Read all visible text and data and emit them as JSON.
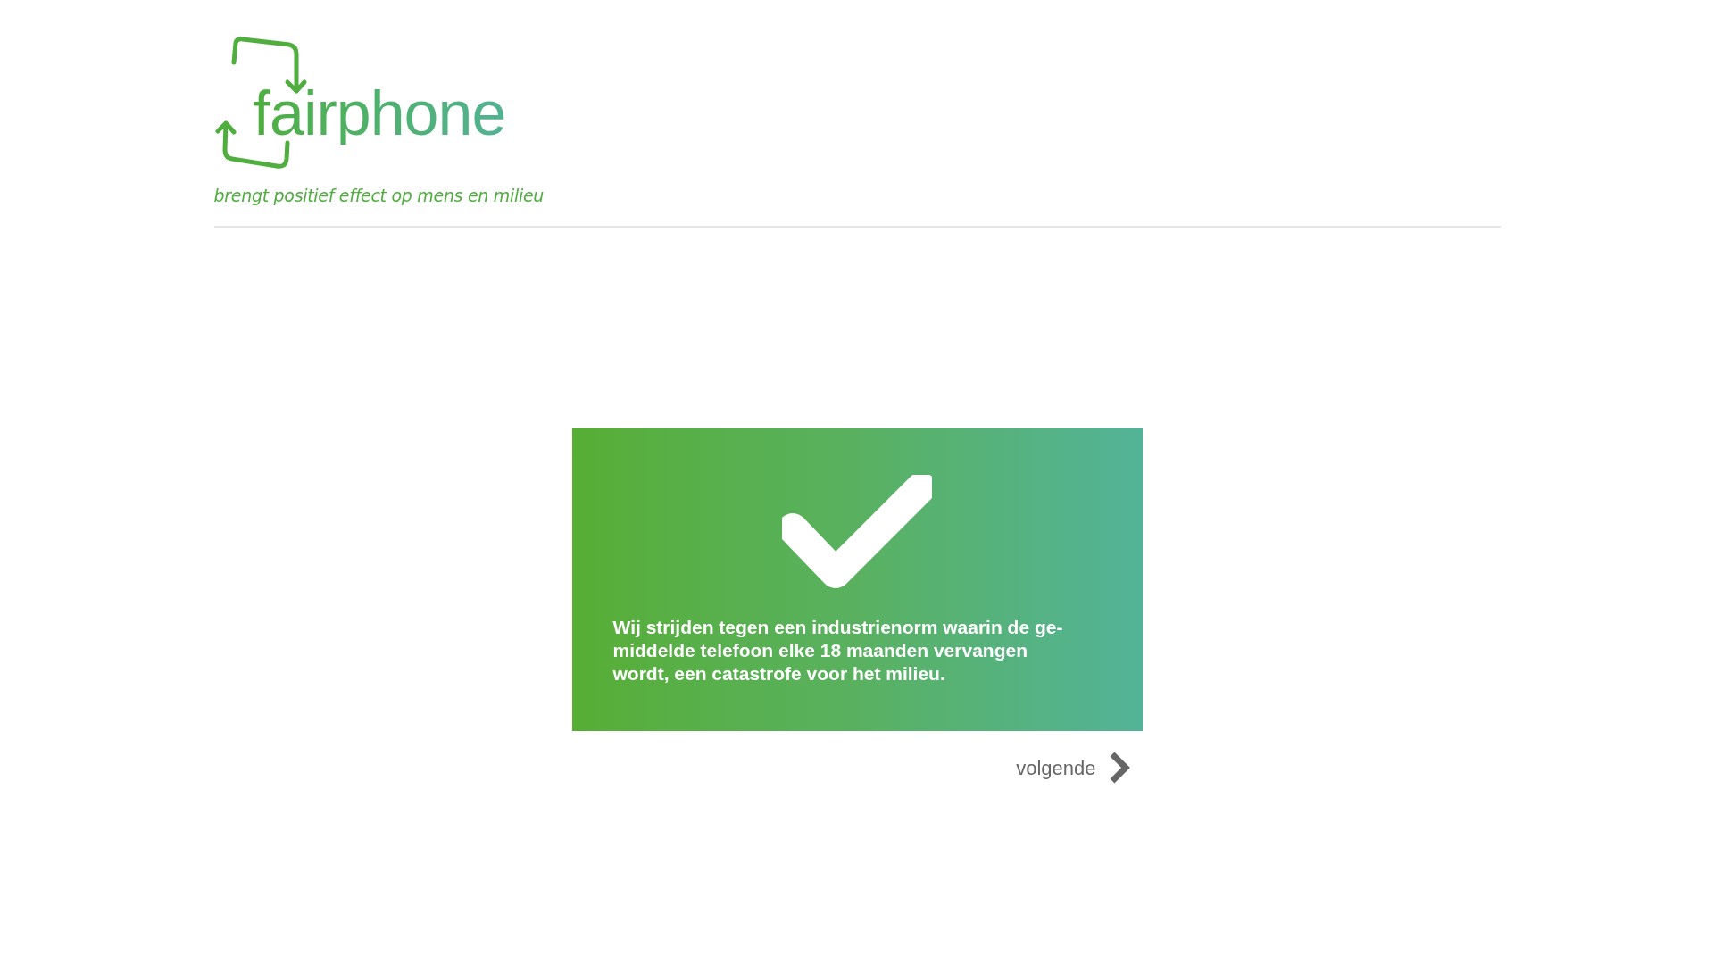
{
  "logo": {
    "wordmark": "fairphone",
    "tagline": "brengt positief effect op mens en milieu"
  },
  "card": {
    "message_lines": [
      "Wij strijden tegen een industrienorm waarin de ge-",
      "middelde telefoon elke 18 maanden vervangen",
      "wordt, een catastrofe voor het milieu."
    ]
  },
  "next_link": {
    "label": "volgende"
  }
}
